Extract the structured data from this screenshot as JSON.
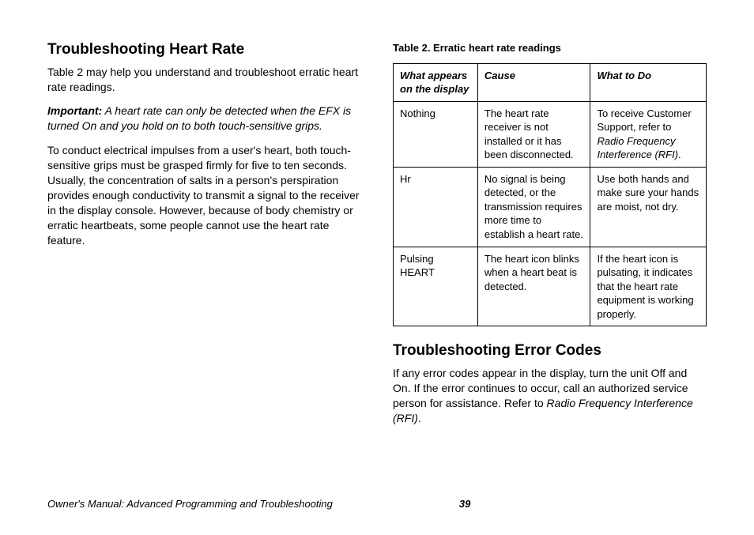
{
  "left": {
    "heading": "Troubleshooting Heart Rate",
    "p1": "Table 2 may help you understand and troubleshoot erratic heart rate readings.",
    "important_label": "Important:",
    "important_text": " A heart rate can only be detected when the EFX is turned On and you hold on to both touch-sensitive grips.",
    "p2": "To conduct electrical impulses from a user's heart, both touch-sensitive grips must be grasped firmly for five to ten seconds. Usually, the concentration of salts in a person's perspiration provides enough conductivity to transmit a signal to the receiver in the display console. However, because of body chemistry or erratic heartbeats, some people cannot use the heart rate feature."
  },
  "right": {
    "table_caption": "Table 2. Erratic heart rate readings",
    "headers": {
      "c1": "What appears on the display",
      "c2": "Cause",
      "c3": "What to Do"
    },
    "rows": [
      {
        "c1": "Nothing",
        "c2": "The heart rate receiver is not installed or it has been disconnected.",
        "c3_pre": "To receive Customer Support, refer to ",
        "c3_rfi": "Radio Frequency Interference (RFI)",
        "c3_post": "."
      },
      {
        "c1": "Hr",
        "c2": "No signal is being detected, or the transmission requires more time to establish a heart rate.",
        "c3_pre": "Use both hands and make sure your hands are moist, not dry.",
        "c3_rfi": "",
        "c3_post": ""
      },
      {
        "c1": "Pulsing HEART",
        "c2": "The heart icon blinks when a heart beat is detected.",
        "c3_pre": "If the heart icon is pulsating, it indicates that the heart rate equipment is working properly.",
        "c3_rfi": "",
        "c3_post": ""
      }
    ],
    "heading2": "Troubleshooting Error Codes",
    "p_err_pre": "If any error codes appear in the display, turn the unit Off and On. If the error continues to occur, call an authorized service person for assistance. Refer to ",
    "p_err_rfi": "Radio Frequency Interference (RFI)",
    "p_err_post": "."
  },
  "footer": {
    "title": "Owner's Manual: Advanced Programming and Troubleshooting",
    "page": "39"
  }
}
